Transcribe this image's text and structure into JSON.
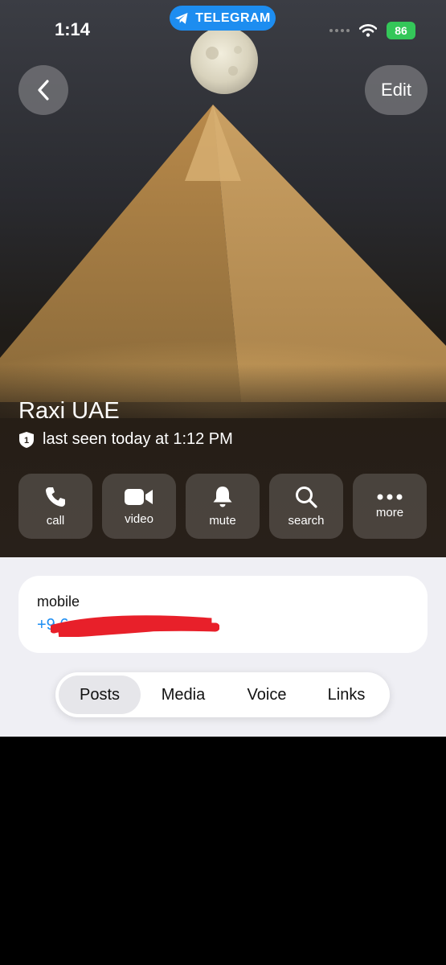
{
  "status_bar": {
    "time": "1:14",
    "app_pill": "TELEGRAM",
    "battery": "86"
  },
  "header": {
    "edit_label": "Edit"
  },
  "profile": {
    "name": "Raxi UAE",
    "badge": "1",
    "last_seen": "last seen today at 1:12 PM"
  },
  "actions": [
    {
      "label": "call",
      "icon": "phone-icon"
    },
    {
      "label": "video",
      "icon": "video-camera-icon"
    },
    {
      "label": "mute",
      "icon": "bell-icon"
    },
    {
      "label": "search",
      "icon": "search-icon"
    },
    {
      "label": "more",
      "icon": "more-dots-icon"
    }
  ],
  "info": {
    "caption": "mobile",
    "phone_visible": "+9                6"
  },
  "tabs": [
    {
      "label": "Posts",
      "active": true
    },
    {
      "label": "Media",
      "active": false
    },
    {
      "label": "Voice",
      "active": false
    },
    {
      "label": "Links",
      "active": false
    }
  ],
  "colors": {
    "accent": "#1c8ef3",
    "telegram_pill": "#1d8df0",
    "battery": "#34c759",
    "redaction": "#e8202a"
  }
}
